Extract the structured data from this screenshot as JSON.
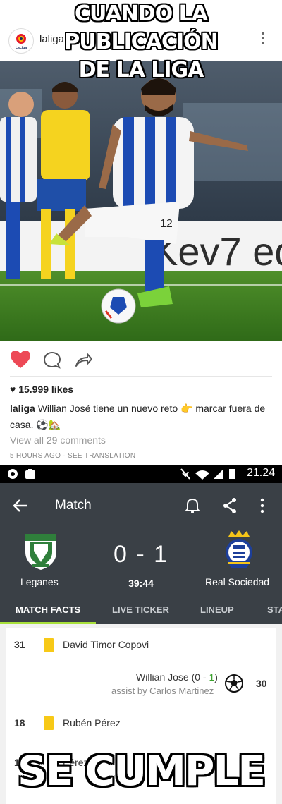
{
  "meme": {
    "top_line1": "CUANDO LA PUBLICACIÓN",
    "top_line2": "DE LA LIGA",
    "bottom": "SE CUMPLE"
  },
  "instagram": {
    "username": "laliga",
    "avatar_text": "LaLiga",
    "photo_ad_text": "Kev7 ed",
    "shirt_number": "12",
    "likes": "♥ 15.999 likes",
    "caption_user": "laliga",
    "caption_text": "Willian José tiene un nuevo reto 👉 marcar fuera de casa. ⚽🏡",
    "comments": "View all 29 comments",
    "timestamp": "5 HOURS AGO · SEE TRANSLATION",
    "icons": [
      "heart-icon",
      "comment-icon",
      "share-icon",
      "more-icon"
    ]
  },
  "android": {
    "status_time": "21.24",
    "title": "Match",
    "home_team": "Leganes",
    "away_team": "Real Sociedad",
    "score": "0 - 1",
    "clock": "39:44",
    "tabs": [
      "MATCH FACTS",
      "LIVE TICKER",
      "LINEUP",
      "STA"
    ],
    "events": [
      {
        "minute": "31",
        "type": "yellow-card",
        "player": "David Timor Copovi"
      },
      {
        "minute": "30",
        "type": "goal",
        "player_pre": "Willian Jose (0 - ",
        "player_score": "1",
        "player_post": ")",
        "assist": "assist by Carlos Martinez"
      },
      {
        "minute": "18",
        "type": "yellow-card",
        "player": "Rubén Pérez"
      },
      {
        "minute": "15",
        "type": "partial",
        "player": "Pérez"
      }
    ],
    "colors": {
      "accent": "#a8e03a",
      "app_bar": "#3a4046",
      "yellow_card": "#f7c917",
      "heart": "#ed4956"
    }
  }
}
